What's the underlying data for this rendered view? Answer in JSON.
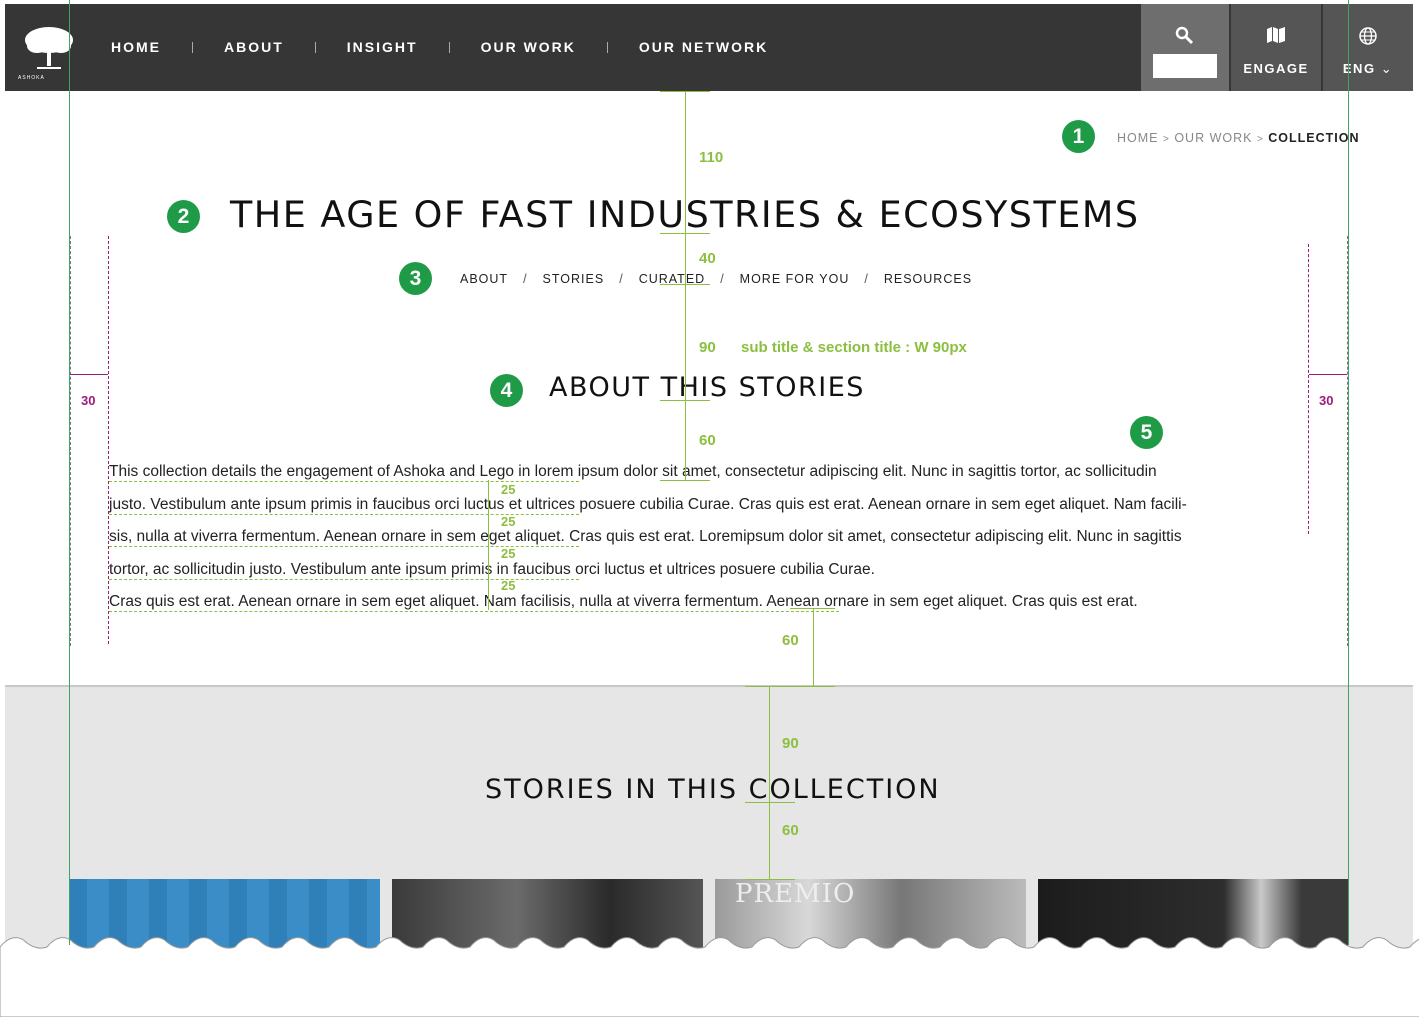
{
  "nav": {
    "logo_text": "ASHOKA",
    "items": [
      "HOME",
      "ABOUT",
      "INSIGHT",
      "OUR WORK",
      "OUR NETWORK"
    ],
    "search_value": "",
    "engage_label": "ENGAGE",
    "lang_label": "ENG"
  },
  "breadcrumb": {
    "home": "HOME",
    "sep1": ">",
    "ourwork": "OUR WORK",
    "sep2": ">",
    "current": "COLLECTION"
  },
  "page_title": "THE AGE OF FAST INDUSTRIES & ECOSYSTEMS",
  "subnav": [
    "ABOUT",
    "STORIES",
    "CURATED",
    "MORE FOR YOU",
    "RESOURCES"
  ],
  "subnav_sep": "/",
  "section_title": "ABOUT THIS STORIES",
  "paragraph_lines": [
    "This collection details the engagement of Ashoka and Lego in lorem ipsum dolor sit amet, consectetur adipiscing elit. Nunc in sagittis tortor, ac sollicitudin",
    "justo. Vestibulum ante ipsum primis in faucibus orci luctus et ultrices posuere cubilia Curae. Cras quis est erat. Aenean ornare in sem eget aliquet. Nam facili-",
    "sis, nulla at viverra fermentum. Aenean ornare in sem eget aliquet. Cras quis est erat. Loremipsum dolor sit amet, consectetur adipiscing elit. Nunc in sagittis",
    "tortor, ac sollicitudin justo. Vestibulum ante ipsum primis in faucibus orci luctus et ultrices posuere cubilia Curae.",
    "Cras quis est erat. Aenean ornare in sem eget aliquet. Nam facilisis, nulla at viverra fermentum. Aenean ornare in sem eget aliquet. Cras quis est erat."
  ],
  "stories_title": "STORIES IN THIS COLLECTION",
  "card3_text": "PREMIO",
  "annotations": {
    "badges": [
      "1",
      "2",
      "3",
      "4",
      "5"
    ],
    "m110": "110",
    "m40": "40",
    "m90a": "90",
    "m60a": "60",
    "m25": [
      "25",
      "25",
      "25",
      "25"
    ],
    "m60b": "60",
    "m90b": "90",
    "m60c": "60",
    "pad_left": "30",
    "pad_right": "30",
    "note": "sub title  &  section title : W 90px"
  },
  "colors": {
    "nav_bg": "#363636",
    "tool_bg": "#555555",
    "guide_green": "#3ea56a",
    "measure_green": "#8cbf3f",
    "padding_magenta": "#9b1c7c",
    "badge_green": "#1f9a47",
    "gray_section": "#e6e6e6"
  }
}
